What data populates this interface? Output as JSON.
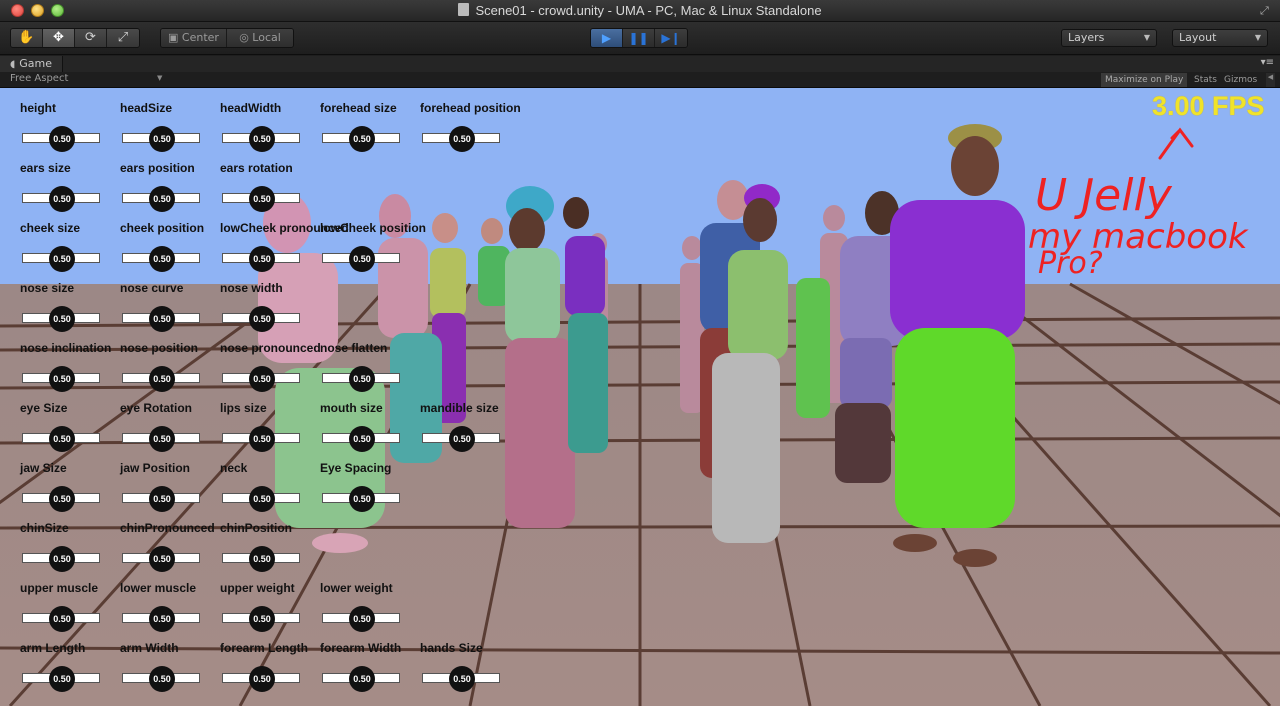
{
  "window": {
    "title": "Scene01 - crowd.unity - UMA - PC, Mac & Linux Standalone"
  },
  "toolbar": {
    "tools": [
      {
        "name": "hand-tool-button",
        "icon": "✋",
        "active": false
      },
      {
        "name": "move-tool-button",
        "icon": "✥",
        "active": true
      },
      {
        "name": "rotate-tool-button",
        "icon": "⟳",
        "active": false
      },
      {
        "name": "scale-tool-button",
        "icon": "⤢",
        "active": false
      }
    ],
    "pivot_label": "Center",
    "space_label": "Local",
    "play_icon": "▶",
    "pause_icon": "❚❚",
    "step_icon": "▶❙",
    "layers_label": "Layers",
    "layout_label": "Layout"
  },
  "game_view": {
    "tab_label": "Game",
    "aspect_label": "Free Aspect",
    "maximize_label": "Maximize on Play",
    "stats_label": "Stats",
    "gizmos_label": "Gizmos"
  },
  "fps_text": "3.00 FPS",
  "handwriting": [
    "U Jelly",
    "my macbook",
    "Pro?"
  ],
  "sliders": {
    "value_text": "0.50",
    "rows": [
      [
        "height",
        "headSize",
        "headWidth",
        "forehead size",
        "forehead position"
      ],
      [
        "ears size",
        "ears position",
        "ears rotation"
      ],
      [
        "cheek size",
        "cheek position",
        "lowCheek pronounced",
        "lowCheek position"
      ],
      [
        "nose size",
        "nose curve",
        "nose width"
      ],
      [
        "nose inclination",
        "nose position",
        "nose pronounced",
        "nose flatten"
      ],
      [
        "eye Size",
        "eye Rotation",
        "lips size",
        "mouth size",
        "mandible size"
      ],
      [
        "jaw Size",
        "jaw Position",
        "neck",
        "Eye Spacing"
      ],
      [
        "chinSize",
        "chinPronounced",
        "chinPosition"
      ],
      [
        "upper muscle",
        "lower muscle",
        "upper weight",
        "lower weight"
      ],
      [
        "arm Length",
        "arm Width",
        "forearm Length",
        "forearm Width",
        "hands Size"
      ]
    ]
  },
  "colors": {
    "sky": "#8fb3f4",
    "ground": "#a38b88",
    "grid_lines": "#5a3d34",
    "fps": "#f0e32a",
    "handwriting": "#ee2222"
  }
}
